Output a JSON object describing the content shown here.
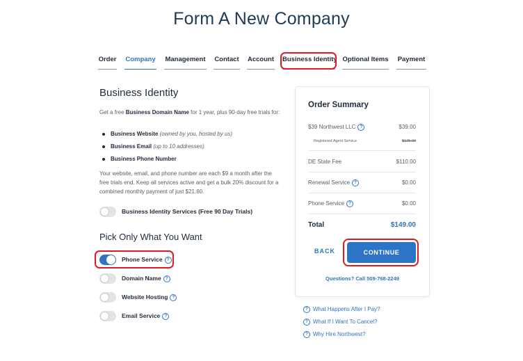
{
  "page": {
    "title": "Form A New Company"
  },
  "tabs": [
    {
      "label": "Order"
    },
    {
      "label": "Company"
    },
    {
      "label": "Management"
    },
    {
      "label": "Contact"
    },
    {
      "label": "Account"
    },
    {
      "label": "Business Identity"
    },
    {
      "label": "Optional Items"
    },
    {
      "label": "Payment"
    }
  ],
  "active_tab": "Company",
  "business_identity": {
    "heading": "Business Identity",
    "intro_prefix": "Get a free ",
    "intro_bold": "Business Domain Name",
    "intro_suffix": " for 1 year, plus 90-day free trials for:",
    "bullets": [
      {
        "label": "Business Website",
        "note": "(owned by you, hosted by us)"
      },
      {
        "label": "Business Email",
        "note": "(up to 10 addresses)"
      },
      {
        "label": "Business Phone Number",
        "note": ""
      }
    ],
    "pricing_text": "Your website, email, and phone number are each $9 a month after the free trials end. Keep all services active and get a bulk 20% discount for a combined monthly payment of just $21.60.",
    "bundle_toggle_label": "Business Identity Services (Free 90 Day Trials)",
    "bundle_toggle_on": false
  },
  "pick": {
    "heading": "Pick Only What You Want",
    "options": [
      {
        "label": "Phone Service",
        "on": true
      },
      {
        "label": "Domain Name",
        "on": false
      },
      {
        "label": "Website Hosting",
        "on": false
      },
      {
        "label": "Email Service",
        "on": false
      }
    ]
  },
  "summary": {
    "heading": "Order Summary",
    "rows": [
      {
        "label": "$39 Northwest LLC",
        "amount": "$39.00"
      },
      {
        "label": "Registered Agent Service",
        "amount": "$125.00"
      },
      {
        "label": "DE State Fee",
        "amount": "$110.00"
      },
      {
        "label": "Renewal Service",
        "amount": "$0.00"
      },
      {
        "label": "Phone Service",
        "amount": "$0.00"
      }
    ],
    "total_label": "Total",
    "total_amount": "$149.00",
    "back_label": "BACK",
    "continue_label": "CONTINUE",
    "questions_text": "Questions? Call 509-768-2249"
  },
  "faq": [
    {
      "label": "What Happens After I Pay?"
    },
    {
      "label": "What If I Want To Cancel?"
    },
    {
      "label": "Why Hire Northwest?"
    }
  ],
  "icons": {
    "question": "question-circle-icon"
  },
  "colors": {
    "accent": "#2f74c0",
    "primary_button": "#2c74c6",
    "highlight": "#e01922",
    "heading": "#1f3a57"
  }
}
